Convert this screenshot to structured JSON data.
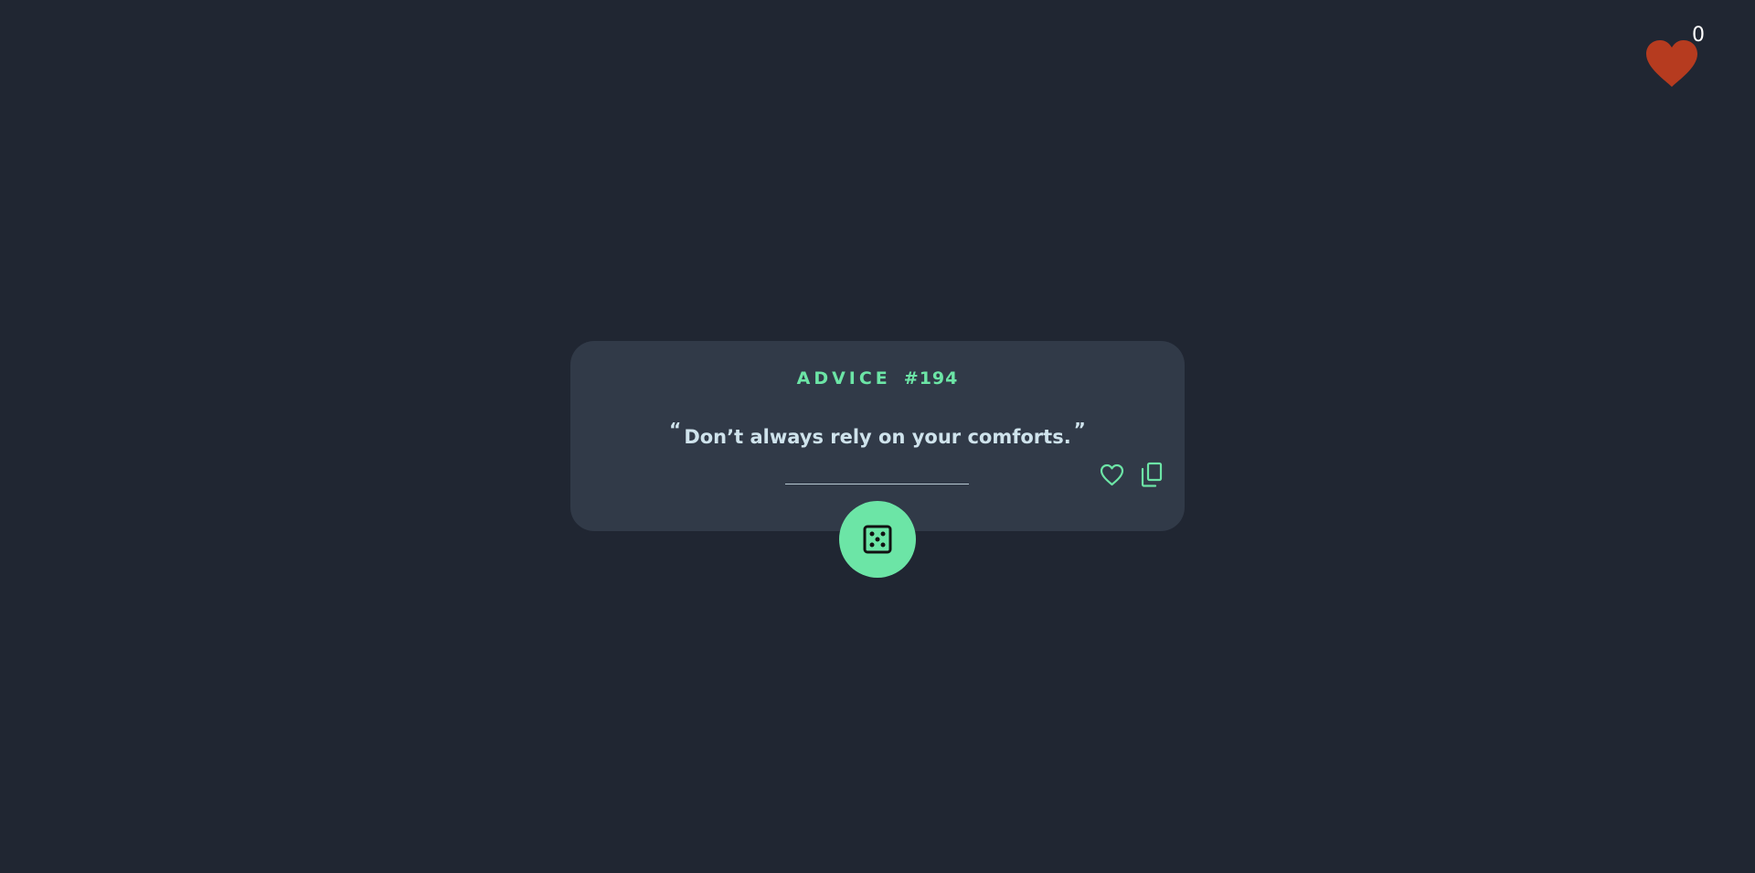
{
  "favorites": {
    "icon": "heart-icon",
    "count": "0",
    "color": "#b63b1f"
  },
  "advice": {
    "label": "ADVICE",
    "number": "#194",
    "open_quote": "“",
    "text": "Don’t always rely on your comforts.",
    "close_quote": "”"
  },
  "actions": {
    "like_icon": "heart-outline-icon",
    "copy_icon": "copy-icon",
    "dice_icon": "dice-icon"
  },
  "colors": {
    "background": "#202632",
    "card": "#313a48",
    "accent": "#6ce5a6",
    "text": "#cfe3ec"
  }
}
